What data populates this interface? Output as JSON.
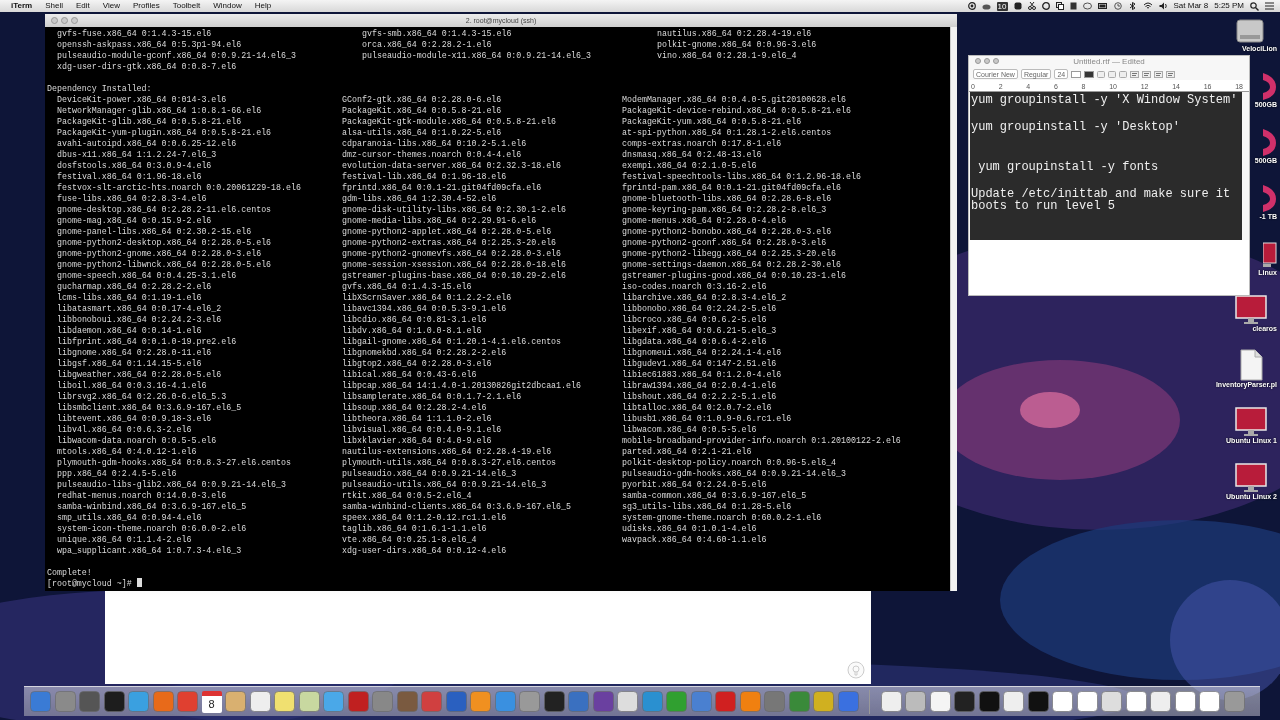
{
  "menu_bar": {
    "app": "iTerm",
    "items": [
      "Shell",
      "Edit",
      "View",
      "Profiles",
      "Toolbelt",
      "Window",
      "Help"
    ],
    "badge": "10",
    "date": "Sat Mar 8",
    "time": "5:25 PM"
  },
  "terminal": {
    "title": "2. root@mycloud (ssh)",
    "installed_tail": [
      [
        "gvfs-fuse.x86_64 0:1.4.3-15.el6",
        "openssh-askpass.x86_64 0:5.3p1-94.el6",
        "pulseaudio-module-gconf.x86_64 0:0.9.21-14.el6_3",
        "xdg-user-dirs-gtk.x86_64 0:0.8-7.el6"
      ],
      [
        "gvfs-smb.x86_64 0:1.4.3-15.el6",
        "orca.x86_64 0:2.28.2-1.el6",
        "pulseaudio-module-x11.x86_64 0:0.9.21-14.el6_3"
      ],
      [
        "nautilus.x86_64 0:2.28.4-19.el6",
        "polkit-gnome.x86_64 0:0.96-3.el6",
        "vino.x86_64 0:2.28.1-9.el6_4"
      ]
    ],
    "heading": "Dependency Installed:",
    "dependencies": [
      [
        "DeviceKit-power.x86_64 0:014-3.el6",
        "NetworkManager-glib.x86_64 1:0.8.1-66.el6",
        "PackageKit-glib.x86_64 0:0.5.8-21.el6",
        "PackageKit-yum-plugin.x86_64 0:0.5.8-21.el6",
        "avahi-autoipd.x86_64 0:0.6.25-12.el6",
        "dbus-x11.x86_64 1:1.2.24-7.el6_3",
        "dosfstools.x86_64 0:3.0.9-4.el6",
        "festival.x86_64 0:1.96-18.el6",
        "festvox-slt-arctic-hts.noarch 0:0.20061229-18.el6",
        "fuse-libs.x86_64 0:2.8.3-4.el6",
        "gnome-desktop.x86_64 0:2.28.2-11.el6.centos",
        "gnome-mag.x86_64 0:0.15.9-2.el6",
        "gnome-panel-libs.x86_64 0:2.30.2-15.el6",
        "gnome-python2-desktop.x86_64 0:2.28.0-5.el6",
        "gnome-python2-gnome.x86_64 0:2.28.0-3.el6",
        "gnome-python2-libwnck.x86_64 0:2.28.0-5.el6",
        "gnome-speech.x86_64 0:0.4.25-3.1.el6",
        "gucharmap.x86_64 0:2.28.2-2.el6",
        "lcms-libs.x86_64 0:1.19-1.el6",
        "libatasmart.x86_64 0:0.17-4.el6_2",
        "libbonoboui.x86_64 0:2.24.2-3.el6",
        "libdaemon.x86_64 0:0.14-1.el6",
        "libfprint.x86_64 0:0.1.0-19.pre2.el6",
        "libgnome.x86_64 0:2.28.0-11.el6",
        "libgsf.x86_64 0:1.14.15-5.el6",
        "libgweather.x86_64 0:2.28.0-5.el6",
        "liboil.x86_64 0:0.3.16-4.1.el6",
        "librsvg2.x86_64 0:2.26.0-6.el6_5.3",
        "libsmbclient.x86_64 0:3.6.9-167.el6_5",
        "libtevent.x86_64 0:0.9.18-3.el6",
        "libv4l.x86_64 0:0.6.3-2.el6",
        "libwacom-data.noarch 0:0.5-5.el6",
        "mtools.x86_64 0:4.0.12-1.el6",
        "plymouth-gdm-hooks.x86_64 0:0.8.3-27.el6.centos",
        "ppp.x86_64 0:2.4.5-5.el6",
        "pulseaudio-libs-glib2.x86_64 0:0.9.21-14.el6_3",
        "redhat-menus.noarch 0:14.0.0-3.el6",
        "samba-winbind.x86_64 0:3.6.9-167.el6_5",
        "smp_utils.x86_64 0:0.94-4.el6",
        "system-icon-theme.noarch 0:6.0.0-2.el6",
        "unique.x86_64 0:1.1.4-2.el6",
        "wpa_supplicant.x86_64 1:0.7.3-4.el6_3"
      ],
      [
        "GConf2-gtk.x86_64 0:2.28.0-6.el6",
        "PackageKit.x86_64 0:0.5.8-21.el6",
        "PackageKit-gtk-module.x86_64 0:0.5.8-21.el6",
        "alsa-utils.x86_64 0:1.0.22-5.el6",
        "cdparanoia-libs.x86_64 0:10.2-5.1.el6",
        "dmz-cursor-themes.noarch 0:0.4-4.el6",
        "evolution-data-server.x86_64 0:2.32.3-18.el6",
        "festival-lib.x86_64 0:1.96-18.el6",
        "fprintd.x86_64 0:0.1-21.git04fd09cfa.el6",
        "gdm-libs.x86_64 1:2.30.4-52.el6",
        "gnome-disk-utility-libs.x86_64 0:2.30.1-2.el6",
        "gnome-media-libs.x86_64 0:2.29.91-6.el6",
        "gnome-python2-applet.x86_64 0:2.28.0-5.el6",
        "gnome-python2-extras.x86_64 0:2.25.3-20.el6",
        "gnome-python2-gnomevfs.x86_64 0:2.28.0-3.el6",
        "gnome-session-xsession.x86_64 0:2.28.0-18.el6",
        "gstreamer-plugins-base.x86_64 0:0.10.29-2.el6",
        "gvfs.x86_64 0:1.4.3-15.el6",
        "libXScrnSaver.x86_64 0:1.2.2-2.el6",
        "libavc1394.x86_64 0:0.5.3-9.1.el6",
        "libcdio.x86_64 0:0.81-3.1.el6",
        "libdv.x86_64 0:1.0.0-8.1.el6",
        "libgail-gnome.x86_64 0:1.20.1-4.1.el6.centos",
        "libgnomekbd.x86_64 0:2.28.2-2.el6",
        "libgtop2.x86_64 0:2.28.0-3.el6",
        "libical.x86_64 0:0.43-6.el6",
        "libpcap.x86_64 14:1.4.0-1.20130826git2dbcaa1.el6",
        "libsamplerate.x86_64 0:0.1.7-2.1.el6",
        "libsoup.x86_64 0:2.28.2-4.el6",
        "libtheora.x86_64 1:1.1.0-2.el6",
        "libvisual.x86_64 0:0.4.0-9.1.el6",
        "libxklavier.x86_64 0:4.0-9.el6",
        "nautilus-extensions.x86_64 0:2.28.4-19.el6",
        "plymouth-utils.x86_64 0:0.8.3-27.el6.centos",
        "pulseaudio.x86_64 0:0.9.21-14.el6_3",
        "pulseaudio-utils.x86_64 0:0.9.21-14.el6_3",
        "rtkit.x86_64 0:0.5-2.el6_4",
        "samba-winbind-clients.x86_64 0:3.6.9-167.el6_5",
        "speex.x86_64 0:1.2-0.12.rc1.1.el6",
        "taglib.x86_64 0:1.6.1-1.1.el6",
        "vte.x86_64 0:0.25.1-8.el6_4",
        "xdg-user-dirs.x86_64 0:0.12-4.el6"
      ],
      [
        "ModemManager.x86_64 0:0.4.0-5.git20100628.el6",
        "PackageKit-device-rebind.x86_64 0:0.5.8-21.el6",
        "PackageKit-yum.x86_64 0:0.5.8-21.el6",
        "at-spi-python.x86_64 0:1.28.1-2.el6.centos",
        "comps-extras.noarch 0:17.8-1.el6",
        "dnsmasq.x86_64 0:2.48-13.el6",
        "exempi.x86_64 0:2.1.0-5.el6",
        "festival-speechtools-libs.x86_64 0:1.2.96-18.el6",
        "fprintd-pam.x86_64 0:0.1-21.git04fd09cfa.el6",
        "gnome-bluetooth-libs.x86_64 0:2.28.6-8.el6",
        "gnome-keyring-pam.x86_64 0:2.28.2-8.el6_3",
        "gnome-menus.x86_64 0:2.28.0-4.el6",
        "gnome-python2-bonobo.x86_64 0:2.28.0-3.el6",
        "gnome-python2-gconf.x86_64 0:2.28.0-3.el6",
        "gnome-python2-libegg.x86_64 0:2.25.3-20.el6",
        "gnome-settings-daemon.x86_64 0:2.28.2-30.el6",
        "gstreamer-plugins-good.x86_64 0:0.10.23-1.el6",
        "iso-codes.noarch 0:3.16-2.el6",
        "libarchive.x86_64 0:2.8.3-4.el6_2",
        "libbonobo.x86_64 0:2.24.2-5.el6",
        "libcroco.x86_64 0:0.6.2-5.el6",
        "libexif.x86_64 0:0.6.21-5.el6_3",
        "libgdata.x86_64 0:0.6.4-2.el6",
        "libgnomeui.x86_64 0:2.24.1-4.el6",
        "libgudev1.x86_64 0:147-2.51.el6",
        "libiec61883.x86_64 0:1.2.0-4.el6",
        "libraw1394.x86_64 0:2.0.4-1.el6",
        "libshout.x86_64 0:2.2.2-5.1.el6",
        "libtalloc.x86_64 0:2.0.7-2.el6",
        "libusb1.x86_64 0:1.0.9-0.6.rc1.el6",
        "libwacom.x86_64 0:0.5-5.el6",
        "mobile-broadband-provider-info.noarch 0:1.20100122-2.el6",
        "parted.x86_64 0:2.1-21.el6",
        "polkit-desktop-policy.noarch 0:0.96-5.el6_4",
        "pulseaudio-gdm-hooks.x86_64 0:0.9.21-14.el6_3",
        "pyorbit.x86_64 0:2.24.0-5.el6",
        "samba-common.x86_64 0:3.6.9-167.el6_5",
        "sg3_utils-libs.x86_64 0:1.28-5.el6",
        "system-gnome-theme.noarch 0:60.0.2-1.el6",
        "udisks.x86_64 0:1.0.1-4.el6",
        "wavpack.x86_64 0:4.60-1.1.el6"
      ]
    ],
    "status": "Complete!",
    "prompt": "[root@mycloud ~]#"
  },
  "text_editor": {
    "title": "Untitled.rtf — Edited",
    "font": "Courier New",
    "style": "Regular",
    "size": "24",
    "ruler": [
      "0",
      "2",
      "4",
      "6",
      "8",
      "10",
      "12",
      "14",
      "16",
      "18"
    ],
    "paragraphs": [
      "yum groupinstall -y 'X Window System'",
      "yum groupinstall -y 'Desktop'",
      " yum groupinstall -y fonts",
      "Update /etc/inittab and make sure it boots to run level 5"
    ]
  },
  "desktop_icons": [
    {
      "label": "VelociLion",
      "kind": "drive"
    },
    {
      "label": "500GB",
      "kind": "disk"
    },
    {
      "label": "500GB",
      "kind": "disk"
    },
    {
      "label": "-1 TB",
      "kind": "disk"
    },
    {
      "label": "Linux",
      "kind": "edge"
    },
    {
      "label": "clearos",
      "kind": "vm"
    },
    {
      "label": "InventoryParser.pl",
      "kind": "file"
    },
    {
      "label": "Ubuntu Linux 1",
      "kind": "vm"
    },
    {
      "label": "Ubuntu Linux 2",
      "kind": "vm"
    }
  ],
  "dock": {
    "calendar_day": "8"
  }
}
